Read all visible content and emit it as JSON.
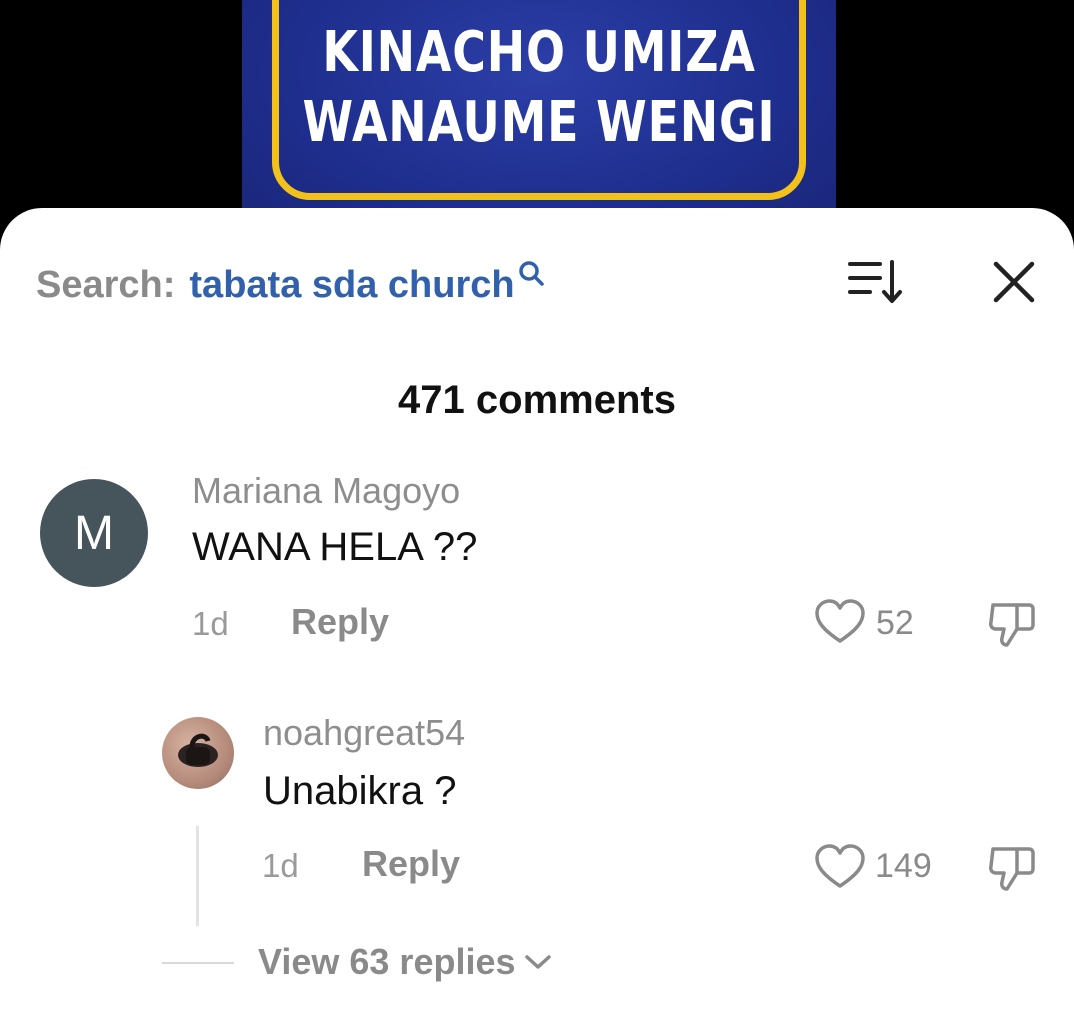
{
  "video": {
    "title_lines": [
      "KINACHO UMIZA",
      "WANAUME WENGI"
    ]
  },
  "search": {
    "label": "Search:",
    "query": "tabata sda church"
  },
  "comments_header": {
    "count_label": "471 comments"
  },
  "comments": [
    {
      "avatar_initial": "M",
      "username": "Mariana Magoyo",
      "text": "WANA HELA ??",
      "time": "1d",
      "reply_label": "Reply",
      "likes": "52"
    },
    {
      "username": "noahgreat54",
      "text": "Unabikra ?",
      "time": "1d",
      "reply_label": "Reply",
      "likes": "149",
      "view_replies_label": "View 63 replies"
    }
  ],
  "icons": {
    "sort": "sort-icon",
    "close": "close-icon",
    "search": "search-icon",
    "like": "heart-icon",
    "dislike": "thumbs-down-icon",
    "expand": "chevron-down-icon"
  },
  "colors": {
    "accent_link": "#3161ad",
    "thumb_background": "#1f2f8f",
    "thumb_border": "#f2c21a",
    "avatar_m": "#46545c"
  }
}
